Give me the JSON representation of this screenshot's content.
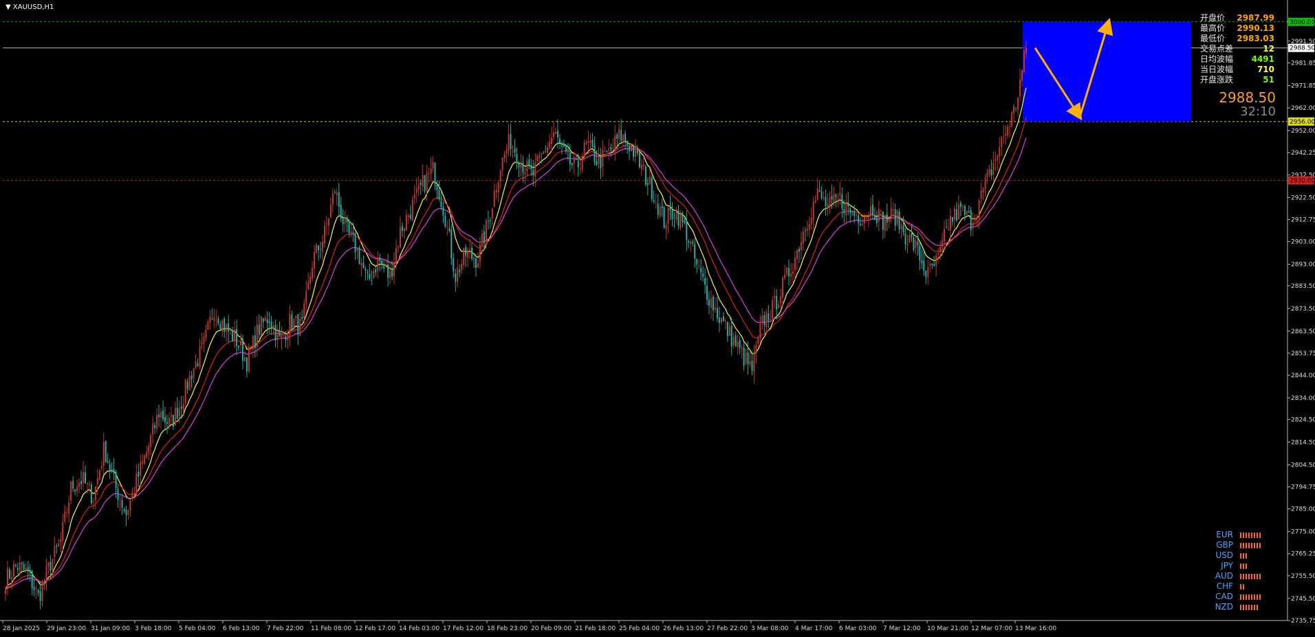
{
  "symbol": {
    "title": "XAUUSD,H1"
  },
  "stats": [
    {
      "label": "开盘价",
      "value": "2987.99",
      "color": "#ffa500"
    },
    {
      "label": "最高价",
      "value": "2990.13",
      "color": "#ffa500"
    },
    {
      "label": "最低价",
      "value": "2983.03",
      "color": "#ffa500"
    },
    {
      "label": "交易点差",
      "value": "12",
      "color": "#ffff4d"
    },
    {
      "label": "日均波幅",
      "value": "4491",
      "color": "#7cfc00"
    },
    {
      "label": "当日波幅",
      "value": "710",
      "color": "#ffff4d"
    },
    {
      "label": "开盘涨跌",
      "value": "51",
      "color": "#7cfc00"
    }
  ],
  "current_price": "2988.50",
  "countdown": "32:10",
  "currencies": [
    {
      "code": "EUR",
      "strength": 8
    },
    {
      "code": "GBP",
      "strength": 8
    },
    {
      "code": "USD",
      "strength": 3
    },
    {
      "code": "JPY",
      "strength": 3
    },
    {
      "code": "AUD",
      "strength": 8
    },
    {
      "code": "CHF",
      "strength": 2
    },
    {
      "code": "CAD",
      "strength": 8
    },
    {
      "code": "NZD",
      "strength": 7
    }
  ],
  "colors": {
    "up_candle": "#c0392b",
    "down_candle": "#20b2aa",
    "ma_fast": "#ffff33",
    "ma_mid": "#e02020",
    "ma_slow": "#e040e0",
    "box": "#0000ff",
    "arrow": "#ffb000",
    "level_high": "#00c000",
    "level_mid": "#dddd00",
    "level_low": "#d02020",
    "grid_axis": "#bbbbbb",
    "currency_bar": "#ff6a1a"
  },
  "chart_data": {
    "type": "candlestick",
    "ylim": [
      2735.75,
      3006.0
    ],
    "price_ticks": [
      "3000.00",
      "2991.50",
      "2981.85",
      "2971.85",
      "2962.00",
      "2952.00",
      "2942.25",
      "2932.50",
      "2922.50",
      "2912.75",
      "2903.00",
      "2893.00",
      "2883.50",
      "2873.50",
      "2863.50",
      "2853.75",
      "2844.00",
      "2834.00",
      "2824.50",
      "2814.50",
      "2804.50",
      "2794.75",
      "2785.00",
      "2775.00",
      "2765.25",
      "2755.50",
      "2745.50",
      "2735.75"
    ],
    "time_ticks": [
      "28 Jan 2025",
      "29 Jan 23:00",
      "31 Jan 09:00",
      "3 Feb 18:00",
      "5 Feb 04:00",
      "6 Feb 13:00",
      "7 Feb 22:00",
      "11 Feb 08:00",
      "12 Feb 17:00",
      "14 Feb 03:00",
      "17 Feb 12:00",
      "18 Feb 23:00",
      "20 Feb 09:00",
      "21 Feb 18:00",
      "25 Feb 04:00",
      "26 Feb 13:00",
      "27 Feb 22:00",
      "3 Mar 08:00",
      "4 Mar 17:00",
      "6 Mar 03:00",
      "7 Mar 12:00",
      "10 Mar 21:00",
      "12 Mar 07:00",
      "13 Mar 16:00"
    ],
    "levels": [
      {
        "price": 3000.0,
        "label": "3000.00",
        "kind": "high"
      },
      {
        "price": 2988.5,
        "label": "2988.50",
        "kind": "current"
      },
      {
        "price": 2956.0,
        "label": "2956.00",
        "kind": "mid"
      },
      {
        "price": 2930.0,
        "label": "2930.00",
        "kind": "low"
      }
    ],
    "close_path": [
      2754,
      2760,
      2757,
      2746,
      2760,
      2770,
      2795,
      2798,
      2790,
      2812,
      2795,
      2783,
      2798,
      2812,
      2828,
      2822,
      2832,
      2846,
      2856,
      2874,
      2865,
      2860,
      2850,
      2864,
      2870,
      2859,
      2868,
      2865,
      2895,
      2905,
      2926,
      2908,
      2900,
      2885,
      2895,
      2887,
      2908,
      2918,
      2928,
      2935,
      2916,
      2888,
      2898,
      2895,
      2912,
      2935,
      2948,
      2938,
      2932,
      2942,
      2951,
      2940,
      2935,
      2946,
      2938,
      2942,
      2950,
      2945,
      2935,
      2925,
      2912,
      2917,
      2908,
      2892,
      2880,
      2870,
      2862,
      2854,
      2846,
      2868,
      2874,
      2885,
      2897,
      2912,
      2924,
      2918,
      2922,
      2916,
      2914,
      2918,
      2912,
      2915,
      2906,
      2900,
      2888,
      2895,
      2912,
      2917,
      2912,
      2924,
      2937,
      2950,
      2962,
      2988
    ],
    "projection": {
      "box_low": 2956.0,
      "box_high": 3000.0,
      "path": [
        2988.5,
        2958.0,
        3000.0
      ]
    }
  }
}
